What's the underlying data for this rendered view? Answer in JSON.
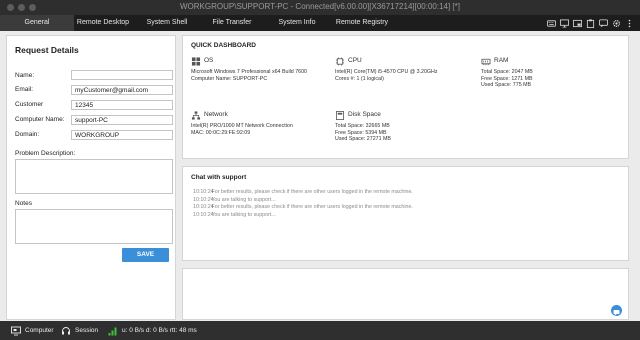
{
  "window": {
    "title": "WORKGROUP\\SUPPORT-PC - Connected[v6.00.00][X36717214][00:00:14] [*]"
  },
  "tabs": [
    {
      "label": "General"
    },
    {
      "label": "Remote Desktop"
    },
    {
      "label": "System Shell"
    },
    {
      "label": "File Transfer"
    },
    {
      "label": "System Info"
    },
    {
      "label": "Remote Registry"
    }
  ],
  "toolbar": {
    "icons": [
      "keyboard-icon",
      "monitor-icon",
      "screen-share-icon",
      "clipboard-icon",
      "chat-icon",
      "settings-icon",
      "more-icon"
    ]
  },
  "request": {
    "title": "Request Details",
    "fields": [
      {
        "label": "Name:",
        "value": ""
      },
      {
        "label": "Email:",
        "value": "myCustomer@gmail.com"
      },
      {
        "label": "Customer",
        "value": "12345"
      },
      {
        "label": "Computer Name:",
        "value": "support-PC"
      },
      {
        "label": "Domain:",
        "value": "WORKGROUP"
      }
    ],
    "problem_label": "Problem Description:",
    "problem_value": "",
    "notes_label": "Notes",
    "notes_value": "",
    "save_label": "SAVE"
  },
  "dashboard": {
    "title": "QUICK DASHBOARD",
    "os": {
      "title": "OS",
      "lines": [
        "Microsoft Windows 7 Professional  x64 Build 7600",
        "Computer Name: SUPPORT-PC"
      ]
    },
    "cpu": {
      "title": "CPU",
      "lines": [
        "Intel(R) Core(TM) i5-4570 CPU @ 3.20GHz",
        "Cores #: 1 (1 logical)"
      ]
    },
    "ram": {
      "title": "RAM",
      "lines": [
        "Total Space: 2047 MB",
        "Free Space: 1271 MB",
        "Used Space: 775 MB"
      ]
    },
    "network": {
      "title": "Network",
      "lines": [
        "Intel(R) PRO/1000 MT Network Connection",
        "MAC: 00:0C:29:FE:92:09"
      ]
    },
    "disk": {
      "title": "Disk Space",
      "lines": [
        "Total Space: 32665 MB",
        "Free Space: 5394 MB",
        "Used Space: 27271 MB"
      ]
    }
  },
  "chat": {
    "title": "Chat with support",
    "messages": [
      {
        "time": "10:10:24",
        "text": "For better results, please check if there are other users logged in the remote machine."
      },
      {
        "time": "10:10:24",
        "text": "You are talking to support..."
      },
      {
        "time": "10:10:24",
        "text": "For better results, please check if there are other users logged in the remote machine."
      },
      {
        "time": "10:10:24",
        "text": "You are talking to support..."
      }
    ],
    "compose_value": ""
  },
  "status": {
    "computer_label": "Computer",
    "session_label": "Session",
    "stats": "u: 0 B/s d: 0 B/s rtt: 48 ms"
  },
  "colors": {
    "accent": "#3a8fd8",
    "signal_green": "#3fbf3f"
  }
}
